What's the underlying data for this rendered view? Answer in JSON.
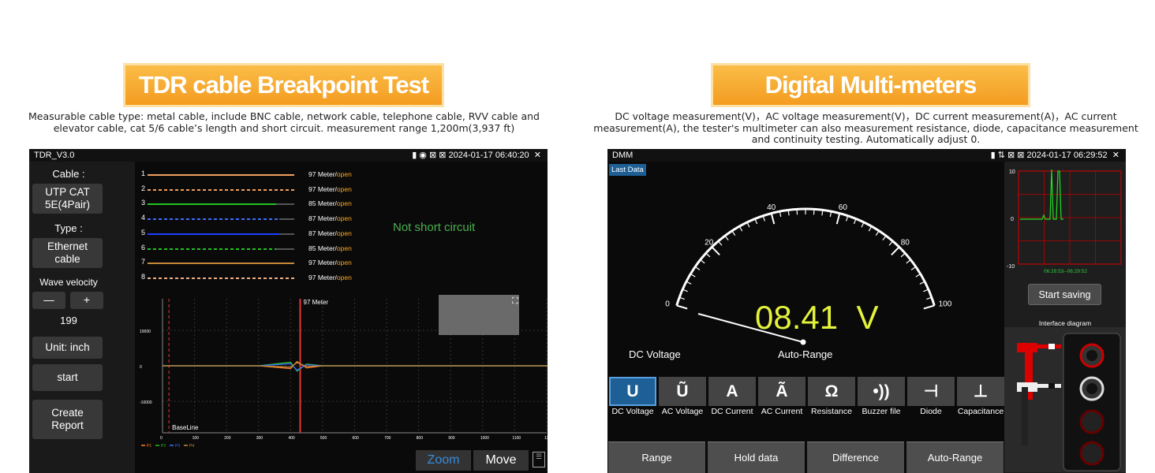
{
  "left": {
    "banner": "TDR cable Breakpoint Test",
    "desc_line1": "Measurable cable type: metal cable, include BNC cable, network cable, telephone cable, RVV cable and",
    "desc_line2": "elevator cable, cat 5/6 cable’s length and short circuit. measurement range 1,200m(3,937 ft)",
    "status_title": "TDR_V3.0",
    "status_time": "2024-01-17 06:40:20",
    "sidebar": {
      "cable_label": "Cable :",
      "cable_value_1": "UTP CAT",
      "cable_value_2": "5E(4Pair)",
      "type_label": "Type :",
      "type_value_1": "Ethernet",
      "type_value_2": "cable",
      "wave_label": "Wave velocity",
      "minus": "—",
      "plus": "+",
      "wave_value": "199",
      "unit": "Unit: inch",
      "start": "start",
      "report_1": "Create",
      "report_2": "Report"
    },
    "pairs": [
      {
        "num": "1",
        "meters": "97 Meter/",
        "state": "open",
        "color": "#f0a060"
      },
      {
        "num": "2",
        "meters": "97 Meter/",
        "state": "open",
        "color": "#f0a060"
      },
      {
        "num": "3",
        "meters": "85 Meter/",
        "state": "open",
        "color": "#22c322"
      },
      {
        "num": "4",
        "meters": "87 Meter/",
        "state": "open",
        "color": "#3b6cff"
      },
      {
        "num": "5",
        "meters": "87 Meter/",
        "state": "open",
        "color": "#1f3fff"
      },
      {
        "num": "6",
        "meters": "85 Meter/",
        "state": "open",
        "color": "#22c322"
      },
      {
        "num": "7",
        "meters": "97 Meter/",
        "state": "open",
        "color": "#c58a3a"
      },
      {
        "num": "8",
        "meters": "97 Meter/",
        "state": "open",
        "color": "#f0b080"
      }
    ],
    "short_status": "Not short circuit",
    "marker_label": "97 Meter",
    "baseline": "BaseLine",
    "y_ticks": [
      "10000",
      "0",
      "-10000"
    ],
    "x_ticks": [
      "0",
      "100",
      "200",
      "300",
      "400",
      "500",
      "600",
      "700",
      "800",
      "900",
      "1000",
      "1100",
      "1200"
    ],
    "legend": [
      "P1",
      "P2",
      "P3",
      "P4"
    ],
    "zoom": "Zoom",
    "move": "Move"
  },
  "right": {
    "banner": "Digital Multi-meters",
    "desc_line1": "DC voltage measurement(V)，AC voltage measurement(V)，DC current measurement(A)，AC current",
    "desc_line2": "measurement(A), the tester's multimeter can also measurement resistance, diode, capacitance measurement",
    "desc_line3": "and continuity testing. Automatically adjust 0.",
    "status_title": "DMM",
    "status_time": "2024-01-17 06:29:52",
    "last_data": "Last Data",
    "gauge_ticks": [
      "0",
      "20",
      "40",
      "60",
      "80",
      "100"
    ],
    "reading": "08.41  V",
    "mode_left": "DC Voltage",
    "mode_right": "Auto-Range",
    "functions": [
      {
        "icon": "U",
        "label": "DC Voltage"
      },
      {
        "icon": "Ũ",
        "label": "AC Voltage"
      },
      {
        "icon": "A",
        "label": "DC Current"
      },
      {
        "icon": "Ã",
        "label": "AC Current"
      },
      {
        "icon": "Ω",
        "label": "Resistance"
      },
      {
        "icon": "•))",
        "label": "Buzzer file"
      },
      {
        "icon": "⊣",
        "label": "Diode"
      },
      {
        "icon": "⊥",
        "label": "Capacitance"
      }
    ],
    "bottom_buttons": [
      "Range",
      "Hold data",
      "Difference",
      "Auto-Range"
    ],
    "mini_chart": {
      "y_ticks": [
        "10",
        "0",
        "-10"
      ],
      "time_range": "06:28:53--06:29:52"
    },
    "start_saving": "Start saving",
    "interface_title": "Interface diagram"
  },
  "chart_data": {
    "type": "line",
    "title": "",
    "xlabel": "",
    "ylabel": "",
    "xlim": [
      0,
      1200
    ],
    "ylim": [
      -20000,
      20000
    ],
    "series": [
      {
        "name": "P1",
        "color": "#ff7f24",
        "x": [
          0,
          100,
          200,
          300,
          400,
          420,
          450,
          500,
          700,
          1200
        ],
        "y": [
          0,
          0,
          0,
          0,
          -800,
          1200,
          -600,
          0,
          0,
          0
        ]
      },
      {
        "name": "P2",
        "color": "#22c322",
        "x": [
          0,
          100,
          200,
          300,
          400,
          420,
          450,
          500,
          700,
          1200
        ],
        "y": [
          0,
          0,
          0,
          0,
          1000,
          -1500,
          500,
          0,
          0,
          0
        ]
      },
      {
        "name": "P3",
        "color": "#3b6cff",
        "x": [
          0,
          100,
          200,
          300,
          400,
          420,
          450,
          500,
          700,
          1200
        ],
        "y": [
          0,
          0,
          0,
          0,
          600,
          -1200,
          300,
          0,
          0,
          0
        ]
      },
      {
        "name": "P4",
        "color": "#c58a3a",
        "x": [
          0,
          100,
          200,
          300,
          400,
          420,
          450,
          500,
          700,
          1200
        ],
        "y": [
          0,
          0,
          0,
          0,
          -400,
          900,
          -200,
          0,
          0,
          0
        ]
      }
    ]
  }
}
